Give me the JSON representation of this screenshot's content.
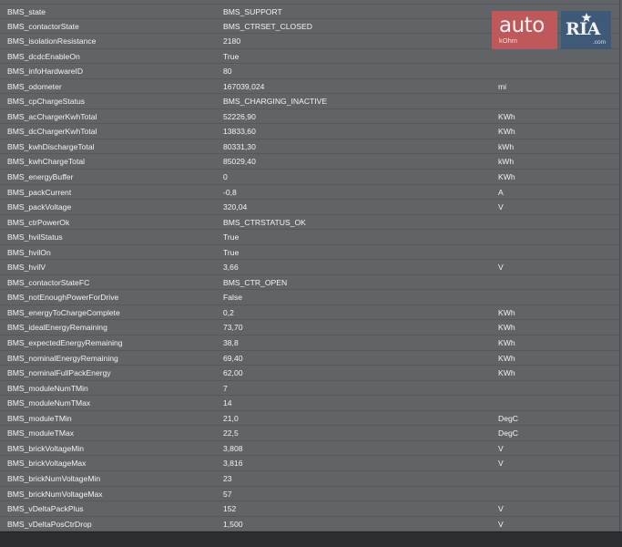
{
  "watermark": {
    "auto_text": "auto",
    "kohm_text": "kOhm",
    "ria_text": "RIA",
    "com_text": ".com"
  },
  "rows": [
    {
      "name": "BMS_state",
      "value": "BMS_SUPPORT",
      "unit": ""
    },
    {
      "name": "BMS_contactorState",
      "value": "BMS_CTRSET_CLOSED",
      "unit": ""
    },
    {
      "name": "BMS_isolationResistance",
      "value": "2180",
      "unit": ""
    },
    {
      "name": "BMS_dcdcEnableOn",
      "value": "True",
      "unit": ""
    },
    {
      "name": "BMS_infoHardwareID",
      "value": "80",
      "unit": ""
    },
    {
      "name": "BMS_odometer",
      "value": "167039,024",
      "unit": "mi"
    },
    {
      "name": "BMS_cpChargeStatus",
      "value": "BMS_CHARGING_INACTIVE",
      "unit": ""
    },
    {
      "name": "BMS_acChargerKwhTotal",
      "value": "52226,90",
      "unit": "KWh"
    },
    {
      "name": "BMS_dcChargerKwhTotal",
      "value": "13833,60",
      "unit": "KWh"
    },
    {
      "name": "BMS_kwhDischargeTotal",
      "value": "80331,30",
      "unit": "kWh"
    },
    {
      "name": "BMS_kwhChargeTotal",
      "value": "85029,40",
      "unit": "kWh"
    },
    {
      "name": "BMS_energyBuffer",
      "value": "0",
      "unit": "KWh"
    },
    {
      "name": "BMS_packCurrent",
      "value": "-0,8",
      "unit": "A"
    },
    {
      "name": "BMS_packVoltage",
      "value": "320,04",
      "unit": "V"
    },
    {
      "name": "BMS_ctrPowerOk",
      "value": "BMS_CTRSTATUS_OK",
      "unit": ""
    },
    {
      "name": "BMS_hvilStatus",
      "value": "True",
      "unit": ""
    },
    {
      "name": "BMS_hvilOn",
      "value": "True",
      "unit": ""
    },
    {
      "name": "BMS_hvilV",
      "value": "3,66",
      "unit": "V"
    },
    {
      "name": "BMS_contactorStateFC",
      "value": "BMS_CTR_OPEN",
      "unit": ""
    },
    {
      "name": "BMS_notEnoughPowerForDrive",
      "value": "False",
      "unit": ""
    },
    {
      "name": "BMS_energyToChargeComplete",
      "value": "0,2",
      "unit": "KWh"
    },
    {
      "name": "BMS_idealEnergyRemaining",
      "value": "73,70",
      "unit": "KWh"
    },
    {
      "name": "BMS_expectedEnergyRemaining",
      "value": "38,8",
      "unit": "KWh"
    },
    {
      "name": "BMS_nominalEnergyRemaining",
      "value": "69,40",
      "unit": "KWh"
    },
    {
      "name": "BMS_nominalFullPackEnergy",
      "value": "62,00",
      "unit": "KWh"
    },
    {
      "name": "BMS_moduleNumTMin",
      "value": "7",
      "unit": ""
    },
    {
      "name": "BMS_moduleNumTMax",
      "value": "14",
      "unit": ""
    },
    {
      "name": "BMS_moduleTMin",
      "value": "21,0",
      "unit": "DegC"
    },
    {
      "name": "BMS_moduleTMax",
      "value": "22,5",
      "unit": "DegC"
    },
    {
      "name": "BMS_brickVoltageMin",
      "value": "3,808",
      "unit": "V"
    },
    {
      "name": "BMS_brickVoltageMax",
      "value": "3,816",
      "unit": "V"
    },
    {
      "name": "BMS_brickNumVoltageMin",
      "value": "23",
      "unit": ""
    },
    {
      "name": "BMS_brickNumVoltageMax",
      "value": "57",
      "unit": ""
    },
    {
      "name": "BMS_vDeltaPackPlus",
      "value": "152",
      "unit": "V"
    },
    {
      "name": "BMS_vDeltaPosCtrDrop",
      "value": "1,500",
      "unit": "V"
    }
  ]
}
